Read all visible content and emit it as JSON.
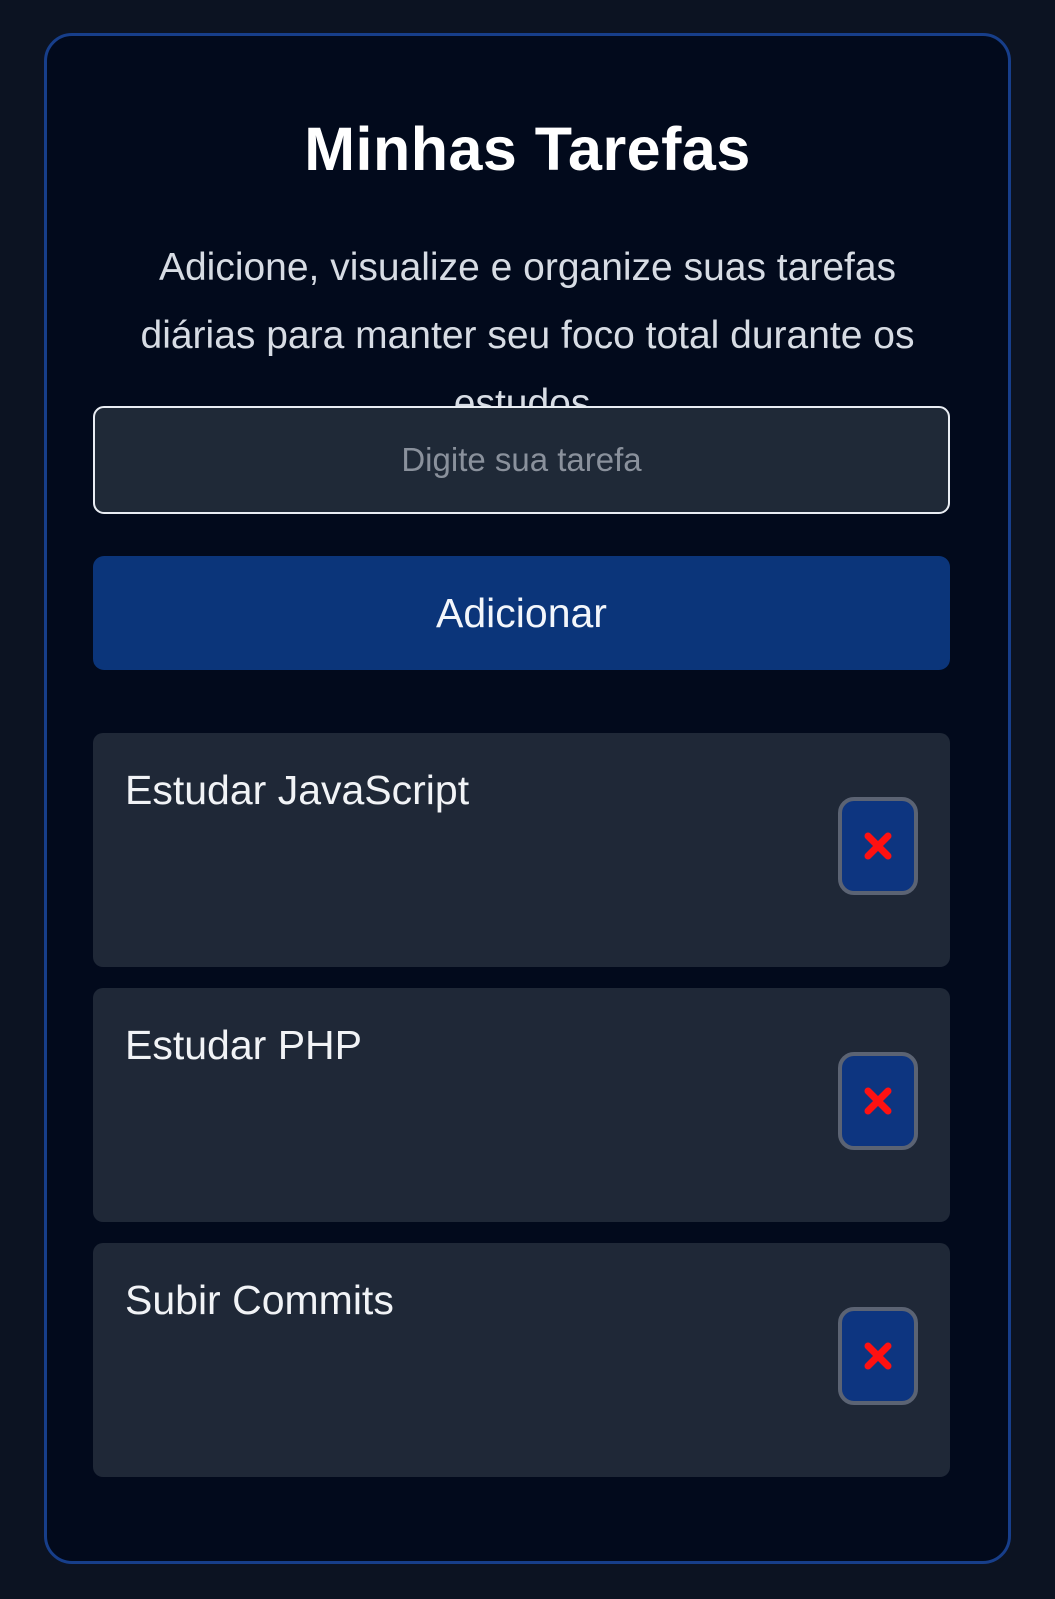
{
  "header": {
    "title": "Minhas Tarefas",
    "subtitle": "Adicione, visualize e organize suas tarefas diárias para manter seu foco total durante os estudos."
  },
  "form": {
    "input_placeholder": "Digite sua tarefa",
    "input_value": "",
    "add_label": "Adicionar"
  },
  "tasks": [
    {
      "text": "Estudar JavaScript",
      "delete_icon": "close-x-icon"
    },
    {
      "text": "Estudar PHP",
      "delete_icon": "close-x-icon"
    },
    {
      "text": "Subir Commits",
      "delete_icon": "close-x-icon"
    }
  ],
  "colors": {
    "page_background": "#0c1322",
    "card_background": "#020a1c",
    "card_border": "#173e8a",
    "accent_button": "#0b357a",
    "task_background": "#1f2837",
    "delete_icon": "#ff1111"
  }
}
